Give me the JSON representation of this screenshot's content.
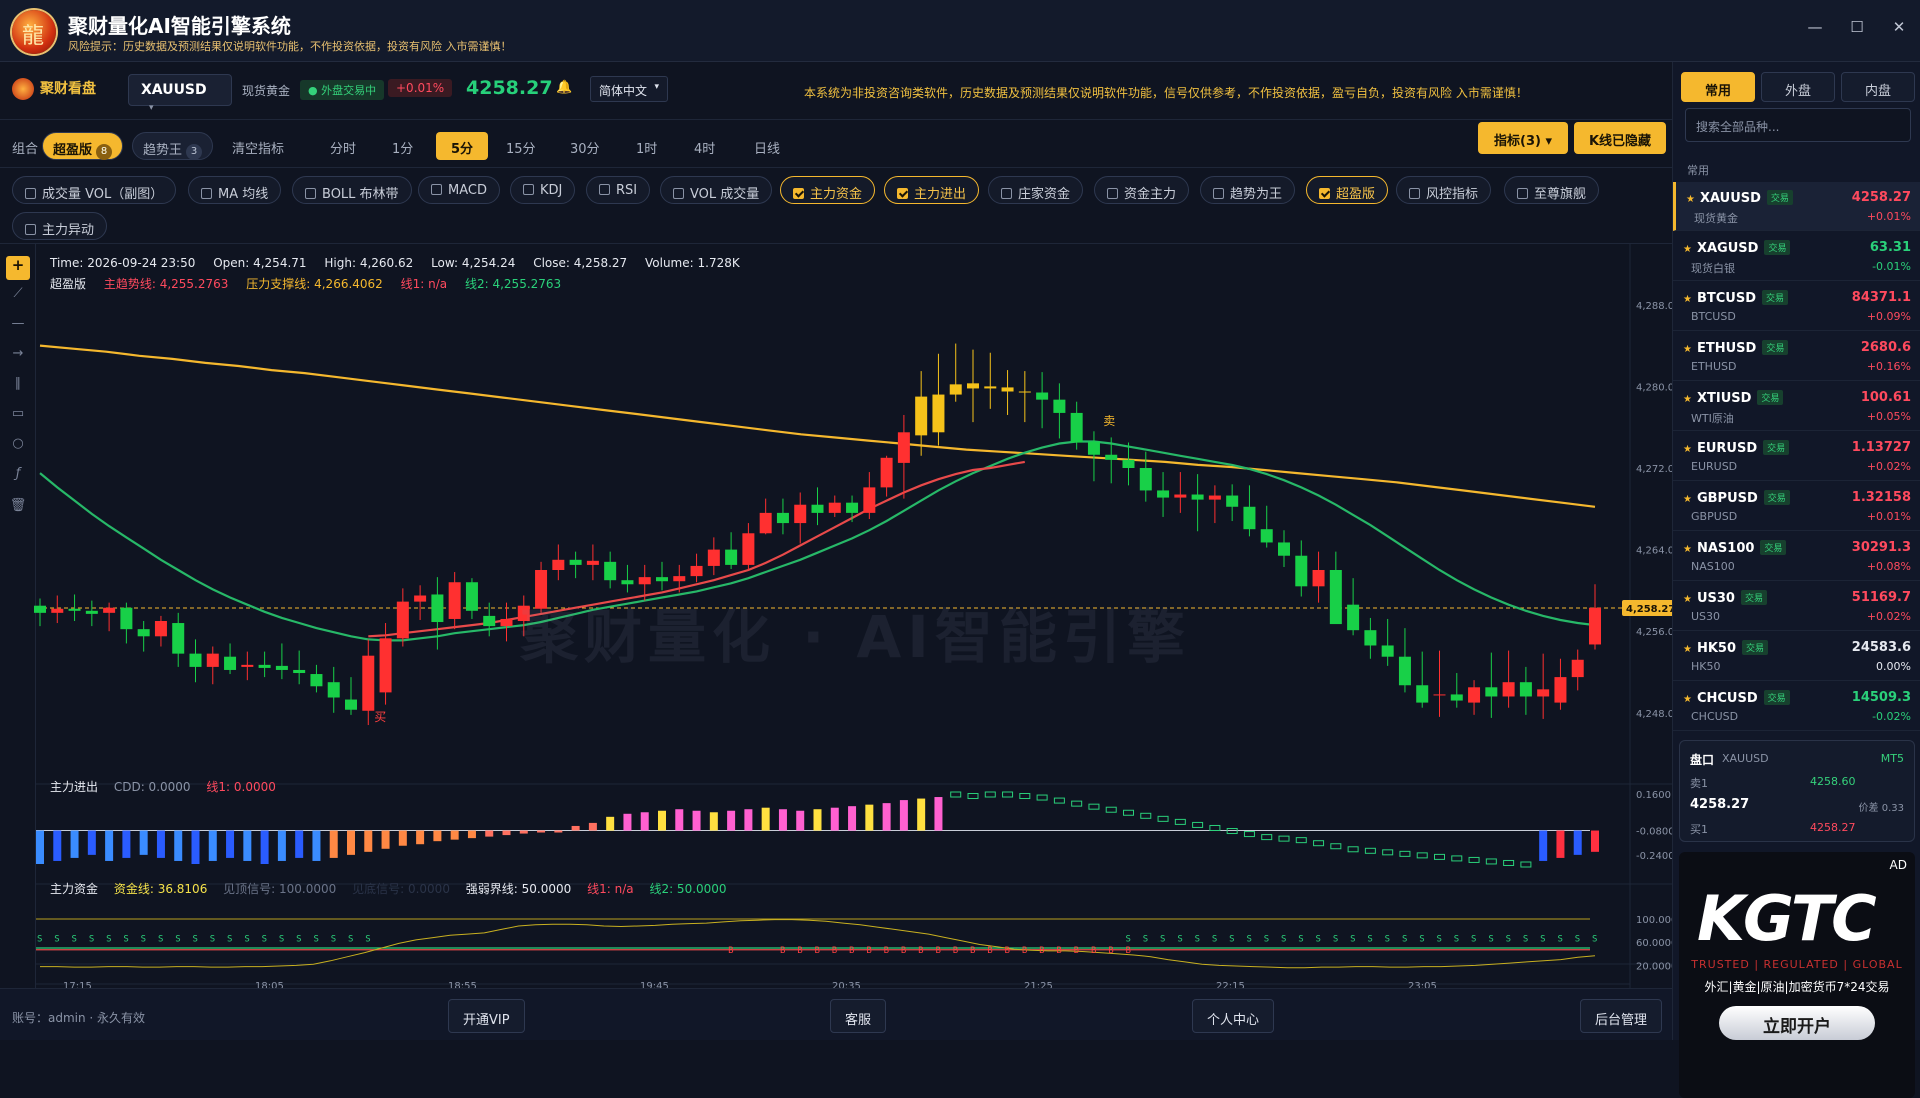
{
  "window": {
    "title": "聚财量化AI智能引擎系统",
    "risk": "风险提示：历史数据及预测结果仅说明软件功能，不作投资依据，投资有风险 入市需谨慎！",
    "controls": [
      "—",
      "☐",
      "✕"
    ]
  },
  "toolbar": {
    "brand": "聚财看盘",
    "symbol": "XAUUSD",
    "symbol_name": "现货黄金",
    "trading": "● 外盘交易中",
    "change_pct": "+0.01%",
    "price": "4258.27",
    "language": "简体中文",
    "notice": "本系统为非投资咨询类软件，历史数据及预测结果仅说明软件功能，信号仅供参考，不作投资依据，盈亏自负，投资有风险 入市需谨慎！"
  },
  "combo": {
    "label": "组合",
    "items": [
      {
        "label": "超盈版",
        "count": "8",
        "active": true
      },
      {
        "label": "趋势王",
        "count": "3",
        "active": false
      },
      {
        "label": "清空指标",
        "count": "",
        "active": false
      }
    ]
  },
  "periods": [
    {
      "label": "分时",
      "active": false
    },
    {
      "label": "1分",
      "active": false
    },
    {
      "label": "5分",
      "active": true
    },
    {
      "label": "15分",
      "active": false
    },
    {
      "label": "30分",
      "active": false
    },
    {
      "label": "1时",
      "active": false
    },
    {
      "label": "4时",
      "active": false
    },
    {
      "label": "日线",
      "active": false
    }
  ],
  "indicator_btn": "指标(3) ▾",
  "kline_btn": "K线已隐藏",
  "indicators": [
    {
      "label": "成交量 VOL（副图）",
      "on": false
    },
    {
      "label": "MA 均线",
      "on": false
    },
    {
      "label": "BOLL 布林带",
      "on": false
    },
    {
      "label": "MACD",
      "on": false
    },
    {
      "label": "KDJ",
      "on": false
    },
    {
      "label": "RSI",
      "on": false
    },
    {
      "label": "VOL 成交量",
      "on": false
    },
    {
      "label": "主力资金",
      "on": true
    },
    {
      "label": "主力进出",
      "on": true
    },
    {
      "label": "庄家资金",
      "on": false
    },
    {
      "label": "资金主力",
      "on": false
    },
    {
      "label": "趋势为王",
      "on": false
    },
    {
      "label": "超盈版",
      "on": true
    },
    {
      "label": "风控指标",
      "on": false
    },
    {
      "label": "至尊旗舰",
      "on": false
    },
    {
      "label": "主力异动",
      "on": false
    }
  ],
  "ohlc": {
    "time": "Time: 2026-09-24 23:50",
    "open": "Open: 4,254.71",
    "high": "High: 4,260.62",
    "low": "Low: 4,254.24",
    "close": "Close: 4,258.27",
    "volume": "Volume: 1.728K"
  },
  "overlay": {
    "name": "超盈版",
    "main": "主趋势线: 4,255.2763",
    "pressure": "压力支撑线: 4,266.4062",
    "l1": "线1: n/a",
    "l2": "线2: 4,255.2763"
  },
  "sub1": {
    "name": "主力进出",
    "cdd": "CDD: 0.0000",
    "l1": "线1: 0.0000"
  },
  "sub2": {
    "name": "主力资金",
    "fund": "资金线: 36.8106",
    "top": "见顶信号: 100.0000",
    "bottom": "见底信号: 0.0000",
    "strong": "强弱界线: 50.0000",
    "l1": "线1: n/a",
    "l2": "线2: 50.0000"
  },
  "watermark": "聚财量化 · AI智能引擎",
  "chart_data": {
    "type": "candlestick",
    "price_axis": [
      "4,288.00",
      "4,280.00",
      "4,272.00",
      "4,264.00",
      "4,256.00",
      "4,248.00"
    ],
    "current_price_label": "4,258.27",
    "time_axis": [
      "17:15",
      "18:05",
      "18:55",
      "19:45",
      "20:35",
      "21:25",
      "22:15",
      "23:05"
    ],
    "sub1_axis": [
      "0.1600",
      "-0.0800",
      "-0.2400"
    ],
    "sub2_axis": [
      "100.0000",
      "60.0000",
      "20.0000"
    ],
    "candles": [
      [
        4258.5,
        4259.2,
        4256.5,
        4257.8
      ],
      [
        4257.8,
        4259.5,
        4256.8,
        4258.2
      ],
      [
        4258.2,
        4259.6,
        4257.0,
        4258.0
      ],
      [
        4258.0,
        4259.0,
        4256.5,
        4257.7
      ],
      [
        4257.8,
        4258.8,
        4256.0,
        4258.3
      ],
      [
        4258.3,
        4258.8,
        4254.8,
        4256.2
      ],
      [
        4256.2,
        4257.0,
        4254.0,
        4255.5
      ],
      [
        4255.5,
        4257.5,
        4254.5,
        4257.0
      ],
      [
        4256.8,
        4257.8,
        4252.5,
        4253.8
      ],
      [
        4253.8,
        4255.2,
        4251.0,
        4252.5
      ],
      [
        4252.5,
        4254.5,
        4250.8,
        4253.8
      ],
      [
        4253.5,
        4254.8,
        4251.8,
        4252.2
      ],
      [
        4252.5,
        4254.0,
        4251.2,
        4252.7
      ],
      [
        4252.7,
        4254.0,
        4251.5,
        4252.4
      ],
      [
        4252.6,
        4254.8,
        4251.3,
        4252.2
      ],
      [
        4252.2,
        4254.1,
        4250.8,
        4251.9
      ],
      [
        4251.8,
        4252.7,
        4250.0,
        4250.6
      ],
      [
        4251.0,
        4252.5,
        4248.0,
        4249.5
      ],
      [
        4249.3,
        4251.5,
        4247.8,
        4248.3
      ],
      [
        4248.2,
        4255.2,
        4246.8,
        4253.6
      ],
      [
        4250.0,
        4256.8,
        4248.8,
        4255.3
      ],
      [
        4255.3,
        4260.2,
        4254.5,
        4258.9
      ],
      [
        4258.9,
        4260.5,
        4257.1,
        4259.5
      ],
      [
        4259.6,
        4261.3,
        4254.2,
        4256.9
      ],
      [
        4257.2,
        4261.8,
        4256.2,
        4260.8
      ],
      [
        4260.8,
        4261.2,
        4257.2,
        4258.0
      ],
      [
        4257.5,
        4258.8,
        4255.5,
        4256.5
      ],
      [
        4256.5,
        4258.8,
        4255.0,
        4257.2
      ],
      [
        4257.0,
        4259.5,
        4255.5,
        4258.5
      ],
      [
        4258.2,
        4262.8,
        4257.8,
        4262.0
      ],
      [
        4262.0,
        4264.5,
        4261.0,
        4263.0
      ],
      [
        4263.0,
        4263.8,
        4261.2,
        4262.5
      ],
      [
        4262.5,
        4264.5,
        4261.0,
        4262.9
      ],
      [
        4262.8,
        4263.8,
        4260.2,
        4261.0
      ],
      [
        4261.0,
        4262.5,
        4259.8,
        4260.6
      ],
      [
        4260.6,
        4262.5,
        4259.0,
        4261.3
      ],
      [
        4261.3,
        4262.8,
        4260.0,
        4260.9
      ],
      [
        4260.9,
        4262.5,
        4259.8,
        4261.4
      ],
      [
        4261.4,
        4263.6,
        4260.8,
        4262.4
      ],
      [
        4262.4,
        4265.2,
        4261.5,
        4264.0
      ],
      [
        4264.0,
        4265.7,
        4262.1,
        4262.5
      ],
      [
        4262.5,
        4266.6,
        4262.0,
        4265.6
      ],
      [
        4265.6,
        4269.0,
        4265.5,
        4267.6
      ],
      [
        4267.6,
        4269.0,
        4265.5,
        4266.6
      ],
      [
        4266.6,
        4269.6,
        4264.6,
        4268.4
      ],
      [
        4268.4,
        4270.1,
        4266.4,
        4267.6
      ],
      [
        4267.6,
        4269.3,
        4267.2,
        4268.6
      ],
      [
        4268.6,
        4269.3,
        4266.7,
        4267.6
      ],
      [
        4267.6,
        4271.6,
        4267.0,
        4270.1
      ],
      [
        4270.1,
        4273.2,
        4269.2,
        4273.0
      ],
      [
        4272.5,
        4277.2,
        4269.0,
        4275.5
      ],
      [
        4275.2,
        4281.5,
        4273.2,
        4279.0
      ],
      [
        4275.5,
        4283.2,
        4274.2,
        4279.2
      ],
      [
        4279.2,
        4284.2,
        4278.5,
        4280.2
      ],
      [
        4280.3,
        4283.6,
        4276.5,
        4279.8
      ],
      [
        4279.8,
        4283.3,
        4277.8,
        4280.0
      ],
      [
        4279.9,
        4281.6,
        4277.2,
        4279.5
      ],
      [
        4279.5,
        4281.5,
        4276.5,
        4279.4
      ],
      [
        4279.4,
        4281.4,
        4275.9,
        4278.7
      ],
      [
        4278.7,
        4280.3,
        4274.9,
        4277.4
      ],
      [
        4277.4,
        4278.5,
        4273.8,
        4274.5
      ],
      [
        4274.6,
        4275.6,
        4270.7,
        4273.3
      ],
      [
        4273.3,
        4275.0,
        4270.5,
        4272.8
      ],
      [
        4272.8,
        4274.5,
        4270.3,
        4272.0
      ],
      [
        4272.0,
        4273.6,
        4268.7,
        4269.8
      ],
      [
        4269.8,
        4271.6,
        4267.2,
        4269.1
      ],
      [
        4269.1,
        4271.6,
        4267.6,
        4269.4
      ],
      [
        4269.4,
        4271.4,
        4265.8,
        4268.9
      ],
      [
        4268.9,
        4270.3,
        4266.6,
        4269.3
      ],
      [
        4269.3,
        4270.4,
        4266.8,
        4268.2
      ],
      [
        4268.2,
        4270.3,
        4265.3,
        4266.0
      ],
      [
        4266.0,
        4268.3,
        4264.2,
        4264.7
      ],
      [
        4264.7,
        4265.9,
        4262.3,
        4263.4
      ],
      [
        4263.4,
        4264.9,
        4259.4,
        4260.4
      ],
      [
        4260.4,
        4263.8,
        4258.8,
        4262.0
      ],
      [
        4262.0,
        4263.8,
        4256.8,
        4256.7
      ],
      [
        4258.6,
        4261.2,
        4255.6,
        4256.1
      ],
      [
        4256.1,
        4257.3,
        4253.3,
        4254.6
      ],
      [
        4254.6,
        4257.2,
        4252.6,
        4253.5
      ],
      [
        4253.5,
        4256.3,
        4250.0,
        4250.7
      ],
      [
        4250.7,
        4254.0,
        4248.5,
        4249.0
      ],
      [
        4249.8,
        4254.1,
        4247.6,
        4249.8
      ],
      [
        4249.8,
        4251.9,
        4248.5,
        4249.2
      ],
      [
        4249.0,
        4251.2,
        4247.8,
        4250.5
      ],
      [
        4250.5,
        4253.9,
        4247.5,
        4249.6
      ],
      [
        4249.6,
        4254.1,
        4248.5,
        4251.0
      ],
      [
        4251.0,
        4252.5,
        4247.8,
        4249.6
      ],
      [
        4249.6,
        4253.8,
        4247.4,
        4250.3
      ],
      [
        4249.0,
        4253.3,
        4248.3,
        4251.5
      ],
      [
        4251.5,
        4254.2,
        4250.2,
        4253.2
      ],
      [
        4254.7,
        4260.6,
        4254.2,
        4258.3
      ]
    ],
    "green_line": [
      4271.5,
      4270.1,
      4268.8,
      4267.5,
      4266.3,
      4265.2,
      4264.1,
      4263.0,
      4262.0,
      4261.0,
      4260.1,
      4259.3,
      4258.6,
      4257.9,
      4257.3,
      4256.8,
      4256.3,
      4255.9,
      4255.5,
      4255.2,
      4255.1,
      4255.1,
      4255.3,
      4255.5,
      4255.8,
      4256.0,
      4256.2,
      4256.4,
      4256.6,
      4256.9,
      4257.3,
      4257.7,
      4258.1,
      4258.4,
      4258.7,
      4259.0,
      4259.3,
      4259.6,
      4259.9,
      4260.3,
      4260.7,
      4261.2,
      4261.8,
      4262.4,
      4263.0,
      4263.7,
      4264.4,
      4265.1,
      4265.9,
      4266.8,
      4267.8,
      4268.8,
      4269.8,
      4270.7,
      4271.5,
      4272.2,
      4272.9,
      4273.5,
      4274.0,
      4274.4,
      4274.6,
      4274.6,
      4274.4,
      4274.1,
      4273.8,
      4273.5,
      4273.2,
      4272.9,
      4272.6,
      4272.3,
      4271.9,
      4271.4,
      4270.8,
      4270.1,
      4269.3,
      4268.4,
      4267.4,
      4266.4,
      4265.3,
      4264.2,
      4263.1,
      4262.0,
      4261.0,
      4260.1,
      4259.3,
      4258.6,
      4258.0,
      4257.5,
      4257.1,
      4256.8,
      4256.6
    ],
    "red_line": [
      4255.5,
      4255.6,
      4255.8,
      4256.0,
      4256.2,
      4256.4,
      4256.6,
      4256.8,
      4257.1,
      4257.4,
      4257.7,
      4258.0,
      4258.3,
      4258.6,
      4258.9,
      4259.2,
      4259.5,
      4259.8,
      4260.2,
      4260.6,
      4261.0,
      4261.5,
      4262.0,
      4262.7,
      4263.5,
      4264.4,
      4265.3,
      4266.2,
      4267.1,
      4268.0,
      4268.8,
      4269.6,
      4270.3,
      4270.9,
      4271.4,
      4271.8,
      4272.0,
      4272.3,
      4272.6
    ],
    "yellow_line": [
      4284.0,
      4283.7,
      4283.4,
      4283.0,
      4282.7,
      4282.3,
      4282.0,
      4281.6,
      4281.3,
      4280.9,
      4280.5,
      4280.1,
      4279.7,
      4279.3,
      4278.9,
      4278.5,
      4278.1,
      4277.7,
      4277.3,
      4276.9,
      4276.5,
      4276.1,
      4275.7,
      4275.3,
      4275.0,
      4274.7,
      4274.4,
      4274.1,
      4273.8,
      4273.6,
      4273.4,
      4273.2,
      4273.0,
      4272.8,
      4272.6,
      4272.3,
      4272.1,
      4271.8,
      4271.5,
      4271.2,
      4270.9,
      4270.6,
      4270.2,
      4269.8,
      4269.4,
      4269.0,
      4268.6,
      4268.2
    ],
    "sub1_bars": [
      -0.08,
      -0.08,
      -0.08,
      -0.08,
      -0.08,
      -0.08,
      -0.08,
      -0.08,
      -0.08,
      -0.08,
      -0.08,
      -0.08,
      -0.08,
      -0.08,
      -0.08,
      -0.08,
      -0.08,
      -0.08,
      -0.08,
      -0.08,
      -0.08,
      -0.08,
      -0.08,
      -0.08,
      -0.08,
      -0.08,
      -0.08,
      -0.08,
      -0.08,
      -0.08,
      -0.08,
      -0.08,
      -0.08,
      -0.08,
      -0.08,
      -0.08,
      -0.08,
      -0.08,
      -0.08,
      -0.08,
      -0.08,
      -0.08,
      -0.08,
      -0.08,
      -0.08,
      -0.08,
      -0.08,
      -0.08,
      -0.08,
      -0.08,
      -0.08,
      -0.08,
      -0.08,
      -0.08,
      -0.08,
      -0.08,
      -0.08,
      -0.08,
      -0.08,
      -0.08,
      -0.08,
      -0.08,
      -0.08,
      -0.08,
      -0.08,
      -0.08,
      -0.08,
      -0.08,
      -0.08,
      -0.08,
      -0.08,
      -0.08,
      -0.08,
      -0.08,
      -0.08,
      -0.08,
      -0.08,
      -0.08,
      -0.08,
      -0.08,
      -0.08,
      -0.08,
      -0.08,
      -0.08,
      -0.08,
      -0.08,
      -0.08,
      -0.08,
      -0.08,
      -0.08,
      -0.08
    ],
    "sub1_values": [
      -0.3,
      -0.28,
      -0.26,
      -0.24,
      -0.28,
      -0.26,
      -0.24,
      -0.26,
      -0.28,
      -0.3,
      -0.28,
      -0.26,
      -0.28,
      -0.3,
      -0.28,
      -0.26,
      -0.28,
      -0.26,
      -0.24,
      -0.22,
      -0.2,
      -0.18,
      -0.17,
      -0.15,
      -0.14,
      -0.13,
      -0.12,
      -0.11,
      -0.1,
      -0.09,
      -0.08,
      -0.05,
      -0.03,
      0.01,
      0.03,
      0.04,
      0.05,
      0.06,
      0.05,
      0.04,
      0.05,
      0.06,
      0.07,
      0.06,
      0.05,
      0.06,
      0.07,
      0.08,
      0.09,
      0.1,
      0.12,
      0.13,
      0.14,
      0.16,
      0.15,
      0.16,
      0.16,
      0.15,
      0.14,
      0.12,
      0.1,
      0.08,
      0.06,
      0.04,
      0.02,
      0.0,
      -0.02,
      -0.04,
      -0.06,
      -0.08,
      -0.1,
      -0.12,
      -0.13,
      -0.14,
      -0.16,
      -0.18,
      -0.2,
      -0.21,
      -0.22,
      -0.23,
      -0.24,
      -0.25,
      -0.26,
      -0.27,
      -0.28,
      -0.29,
      -0.3,
      -0.28,
      -0.26,
      -0.24,
      -0.22
    ],
    "sub2_fund": [
      18,
      18,
      17,
      17,
      18,
      18,
      17,
      17,
      18,
      18,
      17,
      17,
      18,
      18,
      19,
      20,
      22,
      28,
      35,
      42,
      50,
      58,
      64,
      68,
      72,
      74,
      76,
      82,
      88,
      90,
      91,
      91,
      90,
      88,
      87,
      88,
      89,
      91,
      92,
      93,
      95,
      97,
      98,
      99,
      99,
      98,
      96,
      93,
      90,
      86,
      82,
      78,
      74,
      68,
      62,
      56,
      52,
      48,
      46,
      45,
      45,
      44,
      42,
      40,
      38,
      35,
      30,
      26,
      22,
      20,
      19,
      18,
      17,
      16,
      16,
      17,
      17,
      18,
      18,
      17,
      17,
      18,
      18,
      19,
      20,
      22,
      24,
      26,
      28,
      30,
      34,
      36.8
    ],
    "signals_s_region": "top",
    "signals_b": "B"
  },
  "bottom": {
    "account": "账号：admin · 永久有效",
    "vip": "开通VIP",
    "service": "客服",
    "personal": "个人中心",
    "admin": "后台管理"
  },
  "right": {
    "tabs": [
      {
        "label": "常用",
        "active": true
      },
      {
        "label": "外盘",
        "active": false
      },
      {
        "label": "内盘",
        "active": false
      }
    ],
    "search_placeholder": "搜索全部品种...",
    "section": "常用",
    "quotes": [
      {
        "sym": "XAUUSD",
        "tag": "交易",
        "name": "现货黄金",
        "price": "4258.27",
        "chg": "+0.01%",
        "dir": "up",
        "sel": true
      },
      {
        "sym": "XAGUSD",
        "tag": "交易",
        "name": "现货白银",
        "price": "63.31",
        "chg": "-0.01%",
        "dir": "down",
        "sel": false
      },
      {
        "sym": "BTCUSD",
        "tag": "交易",
        "name": "BTCUSD",
        "price": "84371.1",
        "chg": "+0.09%",
        "dir": "up",
        "sel": false
      },
      {
        "sym": "ETHUSD",
        "tag": "交易",
        "name": "ETHUSD",
        "price": "2680.6",
        "chg": "+0.16%",
        "dir": "up",
        "sel": false
      },
      {
        "sym": "XTIUSD",
        "tag": "交易",
        "name": "WTI原油",
        "price": "100.61",
        "chg": "+0.05%",
        "dir": "up",
        "sel": false
      },
      {
        "sym": "EURUSD",
        "tag": "交易",
        "name": "EURUSD",
        "price": "1.13727",
        "chg": "+0.02%",
        "dir": "up",
        "sel": false
      },
      {
        "sym": "GBPUSD",
        "tag": "交易",
        "name": "GBPUSD",
        "price": "1.32158",
        "chg": "+0.01%",
        "dir": "up",
        "sel": false
      },
      {
        "sym": "NAS100",
        "tag": "交易",
        "name": "NAS100",
        "price": "30291.3",
        "chg": "+0.08%",
        "dir": "up",
        "sel": false
      },
      {
        "sym": "US30",
        "tag": "交易",
        "name": "US30",
        "price": "51169.7",
        "chg": "+0.02%",
        "dir": "up",
        "sel": false
      },
      {
        "sym": "HK50",
        "tag": "交易",
        "name": "HK50",
        "price": "24583.6",
        "chg": "0.00%",
        "dir": "flat",
        "sel": false
      },
      {
        "sym": "CHCUSD",
        "tag": "交易",
        "name": "CHCUSD",
        "price": "14509.3",
        "chg": "-0.02%",
        "dir": "down",
        "sel": false
      }
    ],
    "orderbook": {
      "title": "盘口",
      "sym": "XAUUSD",
      "src": "MT5",
      "sell_label": "卖1",
      "sell": "4258.60",
      "last": "4258.27",
      "spread": "价差 0.33",
      "buy_label": "买1",
      "buy": "4258.27"
    },
    "ad": {
      "tag": "AD",
      "brand": "KGTC",
      "tagline": "TRUSTED | REGULATED | GLOBAL",
      "desc": "外汇|黄金|原油|加密货币7*24交易",
      "cta": "立即开户"
    }
  }
}
